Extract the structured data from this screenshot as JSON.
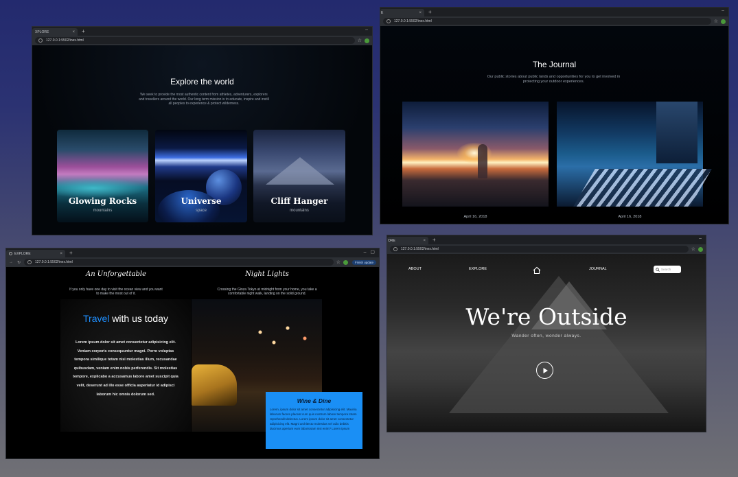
{
  "windows": {
    "explore": {
      "tab_title": "XPLORE",
      "url": "127.0.0.1:5502/inex.html",
      "heading": "Explore the world",
      "description": "We seek to provide the most authentic content from athletes, adventurers, explorers and travellers around the world. Our long term mission is to educate, inspire and instill all peoples to experience & protect wilderness.",
      "cards": [
        {
          "title": "Glowing Rocks",
          "subtitle": "mountains"
        },
        {
          "title": "Universe",
          "subtitle": "space"
        },
        {
          "title": "Cliff Hanger",
          "subtitle": "mountains"
        }
      ]
    },
    "journal": {
      "tab_title": "E",
      "url": "127.0.0.1:5502/inex.html",
      "heading": "The Journal",
      "description": "Our public stories about public lands and opportunities for you to get involved in protecting your outdoor experiences.",
      "dates": [
        "April 16, 2018",
        "April 16, 2018"
      ]
    },
    "travel": {
      "tab_title": "EXPLORE",
      "url": "127.0.0.1:5502/inex.html",
      "update_label": "Finish update",
      "left_title": "An Unforgettable",
      "left_text": "If you only have one day to visit the ocean view and you want to make the most out of it.",
      "right_title": "Night Lights",
      "right_text": "Crossing the Ginza Tokyo at midnight from your home, you take a comfortable night walk, landing on the solid ground.",
      "travel_word": "Travel",
      "travel_rest": " with us today",
      "lorem": "Lorem ipsum dolor sit amet consectetur adipisicing elit. Veniam corporis consequuntur magni. Porro voluptas tempora similique totam nisi molestias illum, recusandae quibusdam, veniam enim nobis perferendis. Sit molestias tempore, explicabo a accusamus labore amet suscipit quia velit, deserunt ad illo esse officia asperiatur id adipisci laborum hic omnis dolorum sed.",
      "wine_title": "Wine & Dine",
      "wine_text": "Lorem, ipsum dolor sit amet consectetur adipisicing elit. Mauiria laborum facere placeat cum quis nostrum labore tempora totam reprehendit delectus. Lorem ipsum dolor sit amet consectetur adipisicing elit. Magni architecto molestias vel odio debitis ducimus aperiam eum laboriosam nisi enim? Lorem ipsum"
    },
    "outside": {
      "tab_title": "ORE",
      "url": "127.0.0.1:5502/inex.html",
      "nav": [
        "ABOUT",
        "EXPLORE",
        "JOURNAL"
      ],
      "search_placeholder": "Search",
      "hero_title": "We're Outside",
      "hero_sub": "Wander often, wonder always."
    }
  },
  "colors": {
    "accent_blue": "#1f8fff",
    "wine_box": "#1a8ff5"
  },
  "icons": [
    "home-icon",
    "search-icon",
    "play-icon",
    "star-icon",
    "lock-icon"
  ]
}
